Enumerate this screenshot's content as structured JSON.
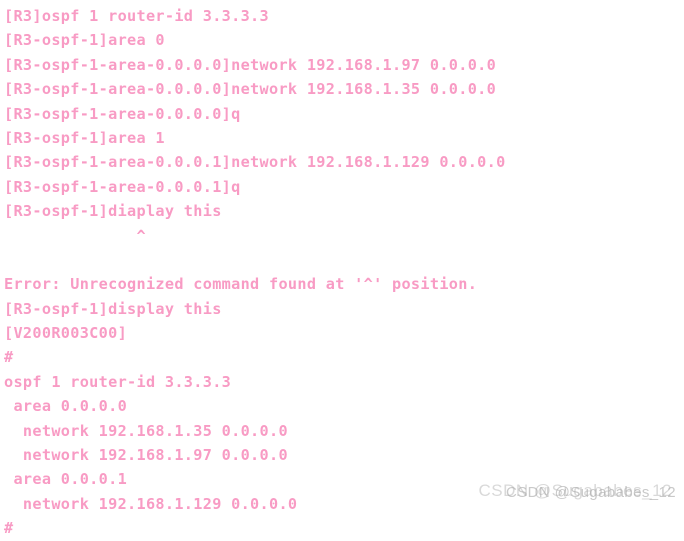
{
  "terminal": {
    "foreground_color": "#f89bc4",
    "background_color": "#ffffff",
    "lines": [
      {
        "id": "cmd-ospf-process",
        "text": "[R3]ospf 1 router-id 3.3.3.3"
      },
      {
        "id": "cmd-area-0",
        "text": "[R3-ospf-1]area 0"
      },
      {
        "id": "cmd-network-97",
        "text": "[R3-ospf-1-area-0.0.0.0]network 192.168.1.97 0.0.0.0"
      },
      {
        "id": "cmd-network-35",
        "text": "[R3-ospf-1-area-0.0.0.0]network 192.168.1.35 0.0.0.0"
      },
      {
        "id": "cmd-quit-area-0",
        "text": "[R3-ospf-1-area-0.0.0.0]q"
      },
      {
        "id": "cmd-area-1",
        "text": "[R3-ospf-1]area 1"
      },
      {
        "id": "cmd-network-129",
        "text": "[R3-ospf-1-area-0.0.0.1]network 192.168.1.129 0.0.0.0"
      },
      {
        "id": "cmd-quit-area-1",
        "text": "[R3-ospf-1-area-0.0.0.1]q"
      },
      {
        "id": "cmd-diaplay-typo",
        "text": "[R3-ospf-1]diaplay this"
      },
      {
        "id": "error-caret-marker",
        "text": "              ^"
      },
      {
        "id": "blank-after-caret",
        "text": " "
      },
      {
        "id": "error-message",
        "text": "Error: Unrecognized command found at '^' position."
      },
      {
        "id": "cmd-display-this",
        "text": "[R3-ospf-1]display this"
      },
      {
        "id": "version-banner",
        "text": "[V200R003C00]"
      },
      {
        "id": "config-separator-top",
        "text": "#"
      },
      {
        "id": "config-ospf-process",
        "text": "ospf 1 router-id 3.3.3.3"
      },
      {
        "id": "config-area-0",
        "text": " area 0.0.0.0"
      },
      {
        "id": "config-network-35",
        "text": "  network 192.168.1.35 0.0.0.0"
      },
      {
        "id": "config-network-97",
        "text": "  network 192.168.1.97 0.0.0.0"
      },
      {
        "id": "config-area-1",
        "text": " area 0.0.0.1"
      },
      {
        "id": "config-network-129",
        "text": "  network 192.168.1.129 0.0.0.0"
      },
      {
        "id": "config-separator-bottom",
        "text": "#"
      }
    ]
  },
  "watermark": {
    "text": "CSDN @Sugababes_12",
    "ghost_text": "CSDN @Sugababes_12",
    "color": "#c9c9c9"
  }
}
